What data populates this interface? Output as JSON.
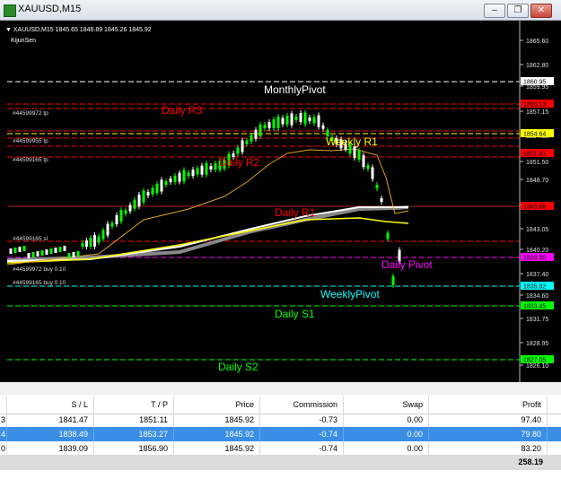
{
  "window": {
    "title": "XAUUSD,M15"
  },
  "chart": {
    "symbol_line": "XAUUSD,M15  1845.65 1846.89 1845.26 1845.92",
    "indicator": "KijunSen",
    "price_scale": [
      "1865.60",
      "1862.80",
      "1859.95",
      "1857.15",
      "1854.35",
      "1851.50",
      "1848.70",
      "1845.85",
      "1843.05",
      "1840.20",
      "1837.40",
      "1834.60",
      "1831.75",
      "1828.95",
      "1826.10"
    ],
    "price_tags": [
      {
        "label": "1860.95",
        "color": "#ffffff",
        "text": "#000000"
      },
      {
        "label": "1858.13",
        "color": "#ff0000",
        "text": "#000000"
      },
      {
        "label": "1854.64",
        "color": "#ffff00",
        "text": "#000000"
      },
      {
        "label": "1851.41",
        "color": "#ff0000",
        "text": "#000000"
      },
      {
        "label": "1845.88",
        "color": "#ff0000",
        "text": "#000000"
      },
      {
        "label": "1839.50",
        "color": "#ff00ff",
        "text": "#000000"
      },
      {
        "label": "1835.92",
        "color": "#00ffff",
        "text": "#000000"
      },
      {
        "label": "1833.45",
        "color": "#00ff00",
        "text": "#000000"
      },
      {
        "label": "1827.05",
        "color": "#00ff00",
        "text": "#000000"
      }
    ],
    "level_labels": {
      "monthly_pivot": "MonthlyPivot",
      "daily_r3": "Daily R3",
      "daily_r2": "Daily R2",
      "daily_r1": "Daily R1",
      "weekly_r1": "Weekly R1",
      "daily_pivot": "Daily Pivot",
      "weekly_pivot": "WeeklyPivot",
      "daily_s1": "Daily S1",
      "daily_s2": "Daily S2"
    },
    "order_labels": {
      "tp1": "#44599972 tp",
      "tp2": "#44599955 tp",
      "tp3": "#44599165 tp",
      "sl1": "#44599165 sl",
      "buy1": "#44599972 buy 0.10",
      "buy2": "#44599165 buy 0.10"
    },
    "colors": {
      "bull": "#00ff00",
      "bear": "#ffffff",
      "r": "#ff0000",
      "pivot": "#ff00ff",
      "wpivot": "#00ffff",
      "s": "#00ff00"
    }
  },
  "trades": {
    "columns": [
      "S / L",
      "T / P",
      "Price",
      "Commission",
      "Swap",
      "Profit"
    ],
    "rows": [
      {
        "lead": "3",
        "sl": "1841.47",
        "tp": "1851.11",
        "price": "1845.92",
        "commission": "-0.73",
        "swap": "0.00",
        "profit": "97.40"
      },
      {
        "lead": "4",
        "sl": "1838.49",
        "tp": "1853.27",
        "price": "1845.92",
        "commission": "-0.74",
        "swap": "0.00",
        "profit": "79.80"
      },
      {
        "lead": "0",
        "sl": "1839.09",
        "tp": "1856.90",
        "price": "1845.92",
        "commission": "-0.74",
        "swap": "0.00",
        "profit": "83.20"
      }
    ],
    "total": "258.19"
  }
}
